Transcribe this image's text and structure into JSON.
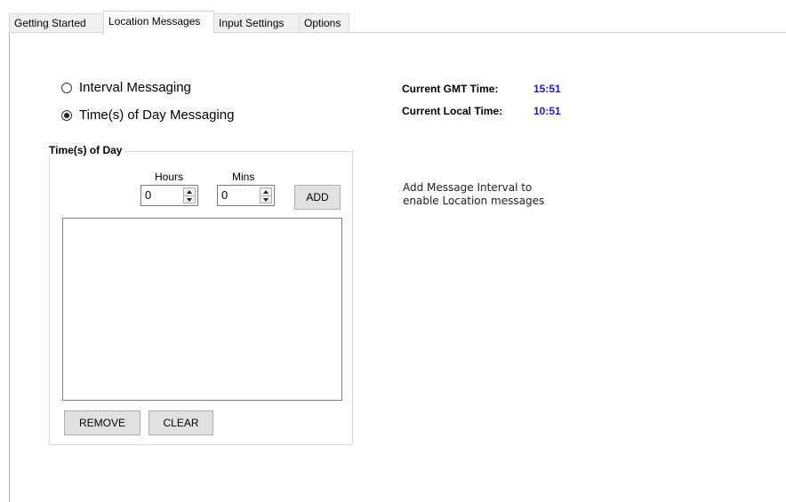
{
  "tabs": [
    {
      "label": "Getting Started",
      "active": false
    },
    {
      "label": "Location Messages",
      "active": true
    },
    {
      "label": "Input Settings",
      "active": false
    },
    {
      "label": "Options",
      "active": false
    }
  ],
  "messaging_mode": {
    "options": [
      {
        "label": "Interval Messaging",
        "selected": false
      },
      {
        "label": "Time(s) of Day Messaging",
        "selected": true
      }
    ]
  },
  "time_of_day_group": {
    "legend": "Time(s) of Day",
    "hours_label": "Hours",
    "mins_label": "Mins",
    "hours_value": "0",
    "mins_value": "0",
    "add_label": "ADD",
    "remove_label": "REMOVE",
    "clear_label": "CLEAR",
    "list_items": []
  },
  "clock": {
    "gmt_label": "Current GMT Time:",
    "gmt_value": "15:51",
    "local_label": "Current Local Time:",
    "local_value": "10:51",
    "value_color": "#1a1ac8"
  },
  "info_message": {
    "line1": "Add Message Interval to",
    "line2": "enable Location messages"
  }
}
